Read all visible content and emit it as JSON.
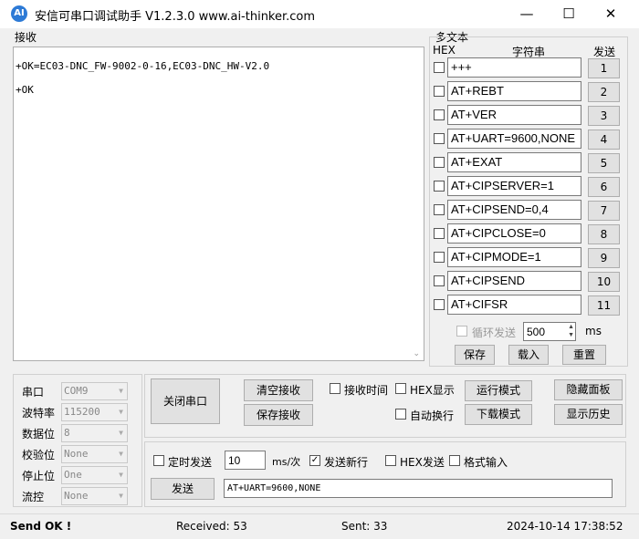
{
  "window": {
    "title": "安信可串口调试助手 V1.2.3.0    www.ai-thinker.com",
    "icon_text": "AI",
    "minimize": "—",
    "maximize": "☐",
    "close": "✕"
  },
  "receive": {
    "label": "接收",
    "lines": [
      "+OK=EC03-DNC_FW-9002-0-16,EC03-DNC_HW-V2.0",
      "+OK"
    ]
  },
  "multitext": {
    "title": "多文本",
    "col_hex": "HEX",
    "col_str": "字符串",
    "col_send": "发送",
    "rows": [
      {
        "value": "+++",
        "num": "1"
      },
      {
        "value": "AT+REBT",
        "num": "2"
      },
      {
        "value": "AT+VER",
        "num": "3"
      },
      {
        "value": "AT+UART=9600,NONE",
        "num": "4"
      },
      {
        "value": "AT+EXAT",
        "num": "5"
      },
      {
        "value": "AT+CIPSERVER=1",
        "num": "6"
      },
      {
        "value": "AT+CIPSEND=0,4",
        "num": "7"
      },
      {
        "value": "AT+CIPCLOSE=0",
        "num": "8"
      },
      {
        "value": "AT+CIPMODE=1",
        "num": "9"
      },
      {
        "value": "AT+CIPSEND",
        "num": "10"
      },
      {
        "value": "AT+CIFSR",
        "num": "11"
      }
    ],
    "loop_label": "循环发送",
    "loop_ms": "500",
    "ms_unit": "ms",
    "save": "保存",
    "load": "载入",
    "reset": "重置"
  },
  "port": {
    "labels": [
      "串口",
      "波特率",
      "数据位",
      "校验位",
      "停止位",
      "流控"
    ],
    "values": [
      "COM9",
      "115200",
      "8",
      "None",
      "One",
      "None"
    ]
  },
  "controls": {
    "close_port": "关闭串口",
    "clear_rx": "清空接收",
    "save_rx": "保存接收",
    "rx_time": "接收时间",
    "hex_display": "HEX显示",
    "auto_newline": "自动换行",
    "run_mode": "运行模式",
    "download_mode": "下载模式",
    "hide_panel": "隐藏面板",
    "show_history": "显示历史"
  },
  "send": {
    "timed": "定时发送",
    "interval": "10",
    "unit": "ms/次",
    "newline": "发送新行",
    "hex_send": "HEX发送",
    "format_input": "格式输入",
    "send_button": "发送",
    "text": "AT+UART=9600,NONE"
  },
  "status": {
    "sendok": "Send OK !",
    "received": "Received: 53",
    "sent": "Sent: 33",
    "time": "2024-10-14 17:38:52"
  }
}
